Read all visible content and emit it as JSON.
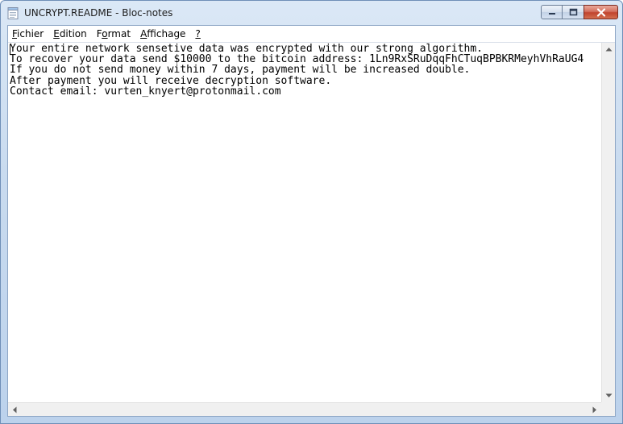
{
  "window": {
    "title": "UNCRYPT.README - Bloc-notes",
    "icon": "notepad-icon"
  },
  "menu": [
    {
      "label": "Fichier",
      "mnemonic": "F",
      "rest": "ichier"
    },
    {
      "label": "Edition",
      "mnemonic": "E",
      "rest": "dition"
    },
    {
      "label": "Format",
      "mnemonic": "o",
      "pre": "F",
      "rest": "rmat"
    },
    {
      "label": "Affichage",
      "mnemonic": "A",
      "rest": "ffichage"
    },
    {
      "label": "?",
      "mnemonic": "?",
      "rest": ""
    }
  ],
  "document": {
    "lines": [
      "Your entire network sensetive data was encrypted with our strong algorithm.",
      "To recover your data send $10000 to the bitcoin address: 1Ln9RxSRuDqqFhCTuqBPBKRMeyhVhRaUG4",
      "If you do not send money within 7 days, payment will be increased double.",
      "After payment you will receive decryption software.",
      "Contact email: vurten_knyert@protonmail.com"
    ]
  },
  "colors": {
    "titlebar": "#c9dbef",
    "close_button": "#c1442e",
    "editor_background": "#ffffff"
  }
}
